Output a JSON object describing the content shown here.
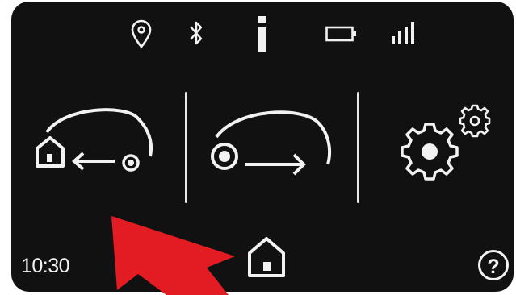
{
  "status_bar": {
    "icons": [
      "location-pin-icon",
      "bluetooth-icon",
      "info-icon",
      "battery-icon",
      "signal-strength-icon"
    ]
  },
  "main_menu": {
    "items": [
      {
        "icon": "park-in-station-icon"
      },
      {
        "icon": "start-mowing-icon"
      },
      {
        "icon": "settings-icon"
      }
    ]
  },
  "footer": {
    "time": "10:30",
    "home_icon": "home-icon",
    "help_icon": "help-icon"
  },
  "annotation": {
    "arrow_color": "#e31b23"
  },
  "colors": {
    "screen_background": "#111111",
    "icon_foreground": "#f2f2f2"
  }
}
